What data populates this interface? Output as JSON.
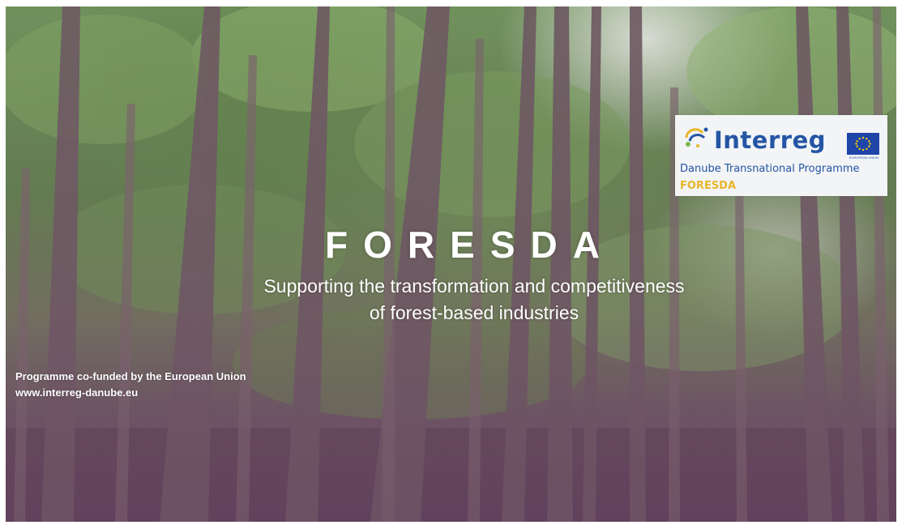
{
  "slide": {
    "title": "FORESDA",
    "subtitle_line1": "Supporting the transformation and competitiveness",
    "subtitle_line2": "of forest-based industries",
    "funding_note": "Programme co-funded by the European Union",
    "website": "www.interreg-danube.eu"
  },
  "logo": {
    "wordmark": "Interreg",
    "eu_caption": "EUROPEAN UNION",
    "programme": "Danube Transnational Programme",
    "project": "FORESDA"
  },
  "colors": {
    "interreg_blue": "#2455a4",
    "foresda_gold": "#e8b62c",
    "eu_flag_blue": "#1f45a8",
    "eu_stars": "#ffd200"
  },
  "icons": [
    "interreg-swirl-icon",
    "eu-flag-icon"
  ]
}
